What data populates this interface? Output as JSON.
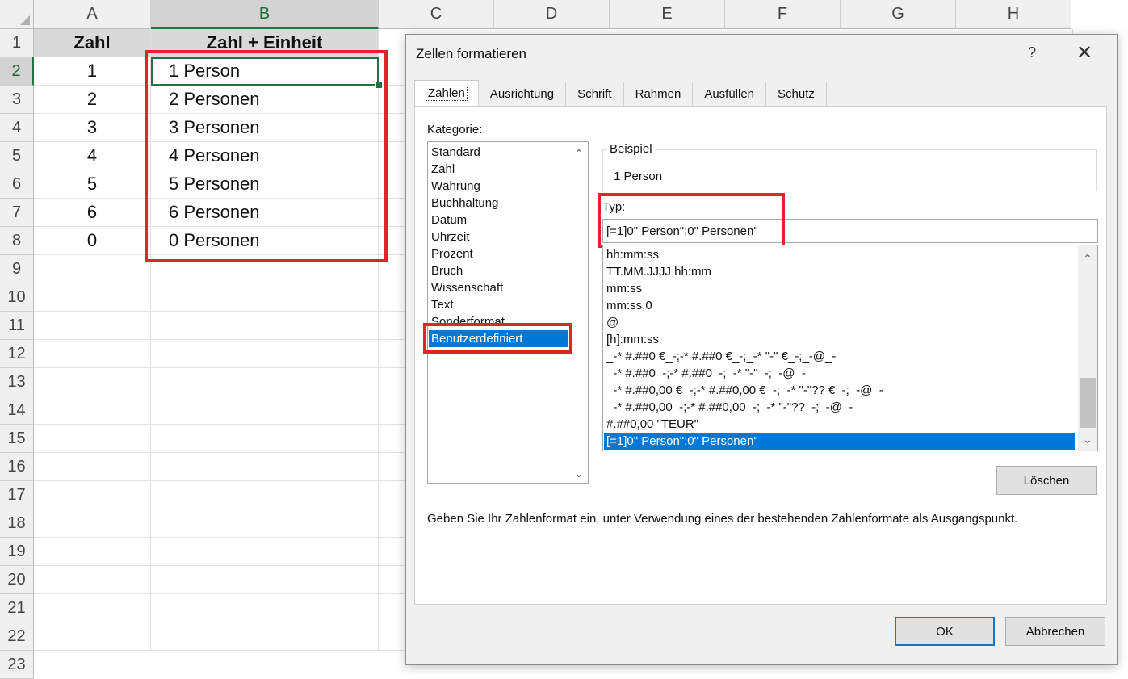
{
  "sheet": {
    "columns": [
      "A",
      "B",
      "C",
      "D",
      "E",
      "F",
      "G",
      "H"
    ],
    "rows": [
      "1",
      "2",
      "3",
      "4",
      "5",
      "6",
      "7",
      "8",
      "9",
      "10",
      "11",
      "12",
      "13",
      "14",
      "15",
      "16",
      "17",
      "18",
      "19",
      "20",
      "21",
      "22",
      "23"
    ],
    "header_a": "Zahl",
    "header_b": "Zahl + Einheit",
    "data": [
      {
        "a": "1",
        "b": "1 Person"
      },
      {
        "a": "2",
        "b": "2 Personen"
      },
      {
        "a": "3",
        "b": "3 Personen"
      },
      {
        "a": "4",
        "b": "4 Personen"
      },
      {
        "a": "5",
        "b": "5 Personen"
      },
      {
        "a": "6",
        "b": "6 Personen"
      },
      {
        "a": "0",
        "b": "0 Personen"
      }
    ]
  },
  "dialog": {
    "title": "Zellen formatieren",
    "help": "?",
    "close": "✕",
    "tabs": [
      "Zahlen",
      "Ausrichtung",
      "Schrift",
      "Rahmen",
      "Ausfüllen",
      "Schutz"
    ],
    "category_label": "Kategorie:",
    "categories": [
      "Standard",
      "Zahl",
      "Währung",
      "Buchhaltung",
      "Datum",
      "Uhrzeit",
      "Prozent",
      "Bruch",
      "Wissenschaft",
      "Text",
      "Sonderformat",
      "Benutzerdefiniert"
    ],
    "sample_label": "Beispiel",
    "sample_value": "1 Person",
    "type_label": "Typ:",
    "type_value": "[=1]0\" Person\";0\" Personen\"",
    "formats": [
      "hh:mm:ss",
      "TT.MM.JJJJ hh:mm",
      "mm:ss",
      "mm:ss,0",
      "@",
      "[h]:mm:ss",
      "_-* #.##0 €_-;-* #.##0 €_-;_-* \"-\" €_-;_-@_-",
      "_-* #.##0_-;-* #.##0_-;_-* \"-\"_-;_-@_-",
      "_-* #.##0,00 €_-;-* #.##0,00 €_-;_-* \"-\"?? €_-;_-@_-",
      "_-* #.##0,00_-;-* #.##0,00_-;_-* \"-\"??_-;_-@_-",
      "#.##0,00 \"TEUR\"",
      "[=1]0\" Person\";0\" Personen\""
    ],
    "delete_button": "Löschen",
    "hint": "Geben Sie Ihr Zahlenformat ein, unter Verwendung eines der bestehenden Zahlenformate als Ausgangspunkt.",
    "ok_button": "OK",
    "cancel_button": "Abbrechen"
  },
  "colors": {
    "highlight_red": "#e3242b",
    "selection_blue": "#0078d7",
    "excel_green": "#217346"
  },
  "icons": {
    "scroll_up": "chevron-up-icon",
    "scroll_down": "chevron-down-icon",
    "close": "close-icon"
  }
}
